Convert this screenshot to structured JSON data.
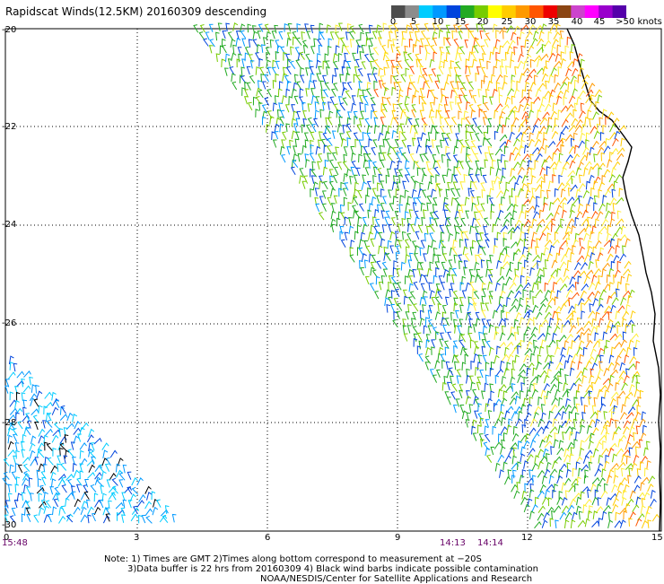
{
  "title": "Rapidscat Winds(12.5KM) 20160309 descending",
  "colorbar": {
    "colors": [
      "#4d4d4d",
      "#8c8c8c",
      "#00ccff",
      "#0099ff",
      "#0044dd",
      "#22aa22",
      "#77cc00",
      "#ffff00",
      "#ffcc00",
      "#ff9900",
      "#ff5500",
      "#ee0000",
      "#8b4513",
      "#cc44cc",
      "#ff00ff",
      "#9900cc",
      "#5500aa"
    ],
    "labels": [
      "0",
      "5",
      "10",
      "15",
      "20",
      "25",
      "30",
      "35",
      "40",
      "45",
      ">50 knots"
    ]
  },
  "axes": {
    "lon_ticks": [
      "0",
      "3",
      "6",
      "9",
      "12",
      "15"
    ],
    "lat_ticks": [
      "-20",
      "-22",
      "-24",
      "-26",
      "-28",
      "-30"
    ],
    "lon_range": [
      0,
      15
    ],
    "lat_range": [
      -30,
      -20
    ],
    "grid": true
  },
  "time_labels": [
    "15:48",
    "14:13",
    "14:14"
  ],
  "notes": {
    "line1": "Note: 1) Times are GMT 2)Times along bottom correspond to measurement at −20S",
    "line2": "3)Data buffer is 22 hrs from 20160309 4) Black wind barbs indicate possible contamination",
    "line3": "NOAA/NESDIS/Center for Satellite Applications and Research"
  }
}
